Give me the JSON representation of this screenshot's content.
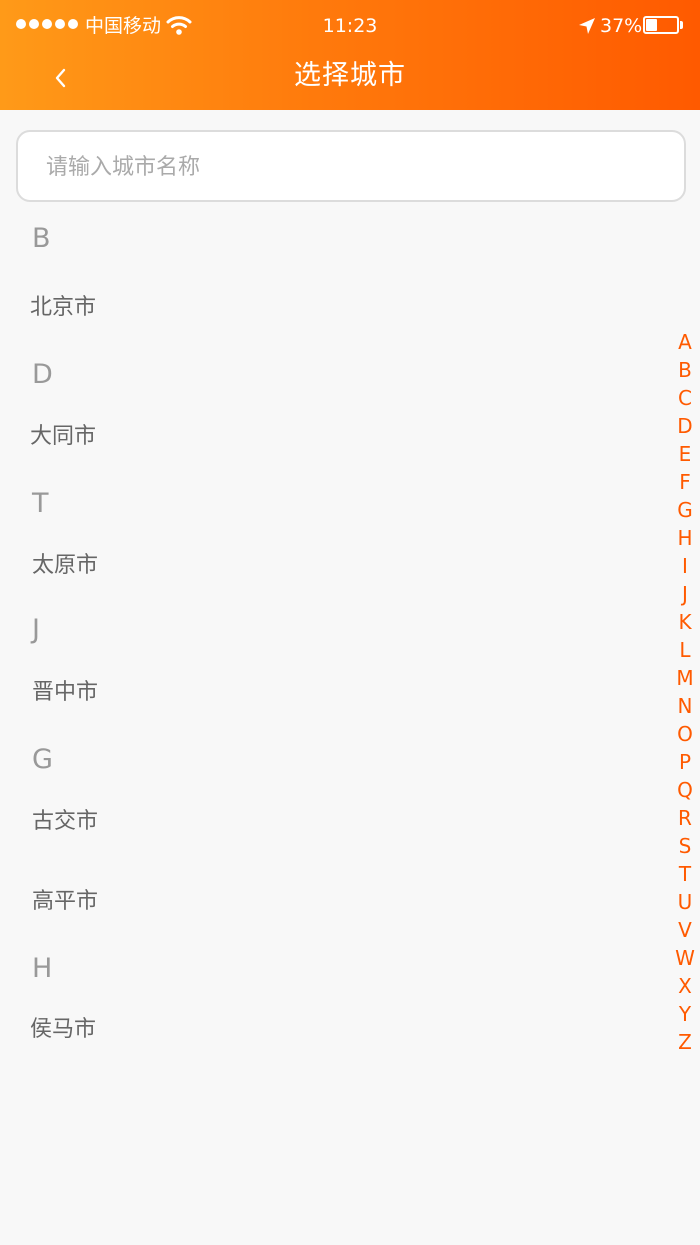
{
  "status_bar": {
    "carrier": "中国移动",
    "time": "11:23",
    "battery": "37%",
    "battery_level": 0.37,
    "icons": [
      "signal-dots-icon",
      "wifi-icon",
      "location-arrow-icon",
      "battery-icon"
    ]
  },
  "nav": {
    "back_icon": "chevron-left-icon",
    "title": "选择城市"
  },
  "search": {
    "placeholder": "请输入城市名称",
    "value": ""
  },
  "sections": [
    {
      "letter": "B",
      "cities": [
        "北京市"
      ]
    },
    {
      "letter": "D",
      "cities": [
        "大同市"
      ]
    },
    {
      "letter": "T",
      "cities": [
        "太原市"
      ]
    },
    {
      "letter": "J",
      "cities": [
        "晋中市"
      ]
    },
    {
      "letter": "G",
      "cities": [
        "古交市",
        "高平市"
      ]
    },
    {
      "letter": "H",
      "cities": [
        "侯马市"
      ]
    }
  ],
  "index": [
    "A",
    "B",
    "C",
    "D",
    "E",
    "F",
    "G",
    "H",
    "I",
    "J",
    "K",
    "L",
    "M",
    "N",
    "O",
    "P",
    "Q",
    "R",
    "S",
    "T",
    "U",
    "V",
    "W",
    "X",
    "Y",
    "Z"
  ],
  "colors": {
    "header_start": "#ff9a18",
    "header_end": "#ff5a00",
    "index_letter": "#ff5a00",
    "section_letter": "#999999",
    "city_text": "#666666"
  }
}
